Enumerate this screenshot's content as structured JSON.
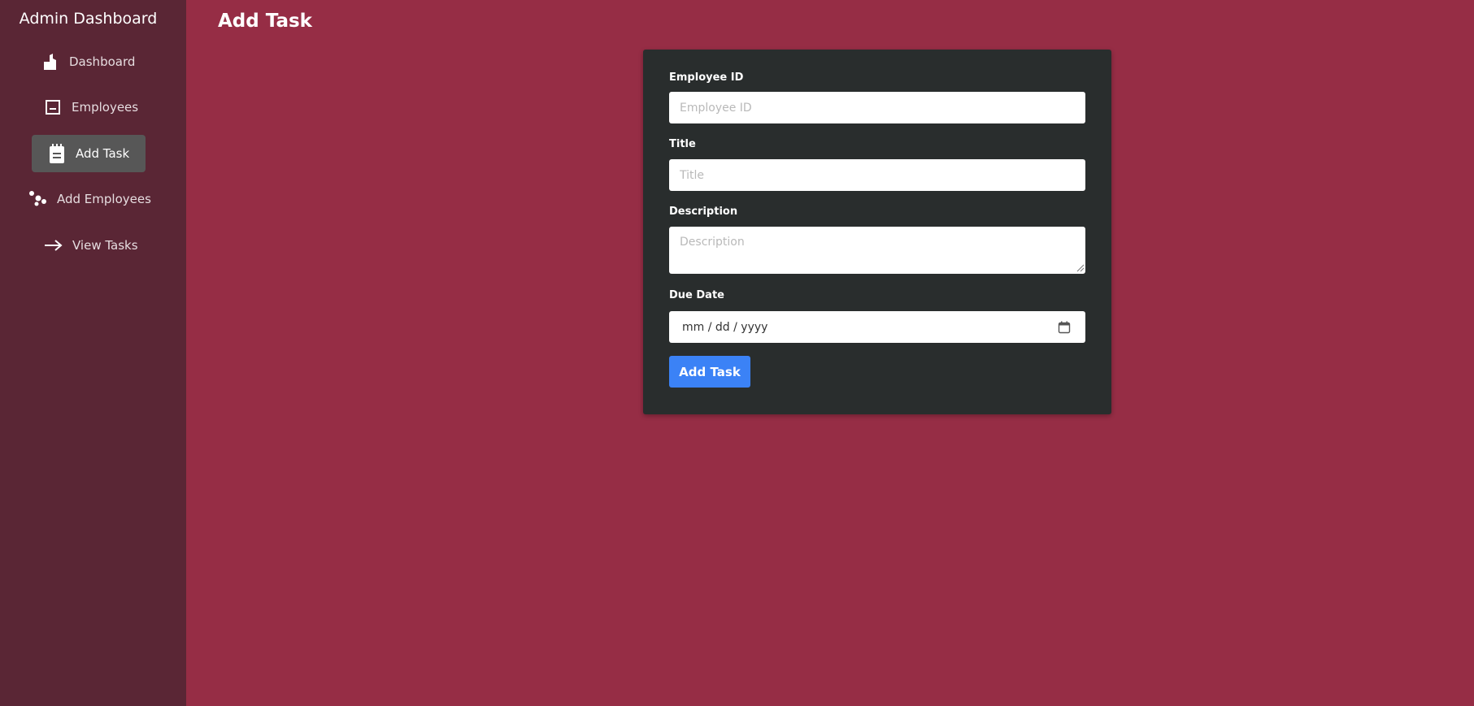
{
  "sidebar": {
    "title": "Admin Dashboard",
    "items": [
      {
        "label": "Dashboard",
        "icon": "dashboard-icon"
      },
      {
        "label": "Employees",
        "icon": "employees-icon"
      },
      {
        "label": "Add Task",
        "icon": "clipboard-icon",
        "active": true
      },
      {
        "label": "Add Employees",
        "icon": "add-employees-icon"
      },
      {
        "label": "View Tasks",
        "icon": "arrow-right-icon"
      }
    ]
  },
  "page": {
    "title": "Add Task"
  },
  "form": {
    "employee_id": {
      "label": "Employee ID",
      "placeholder": "Employee ID",
      "value": ""
    },
    "title": {
      "label": "Title",
      "placeholder": "Title",
      "value": ""
    },
    "description": {
      "label": "Description",
      "placeholder": "Description",
      "value": ""
    },
    "due_date": {
      "label": "Due Date",
      "placeholder": "mm / dd / yyyy",
      "icon": "calendar-icon"
    },
    "submit_label": "Add Task"
  },
  "colors": {
    "background": "#962d45",
    "sidebar": "#5a2635",
    "card": "#292d2d",
    "active_item": "#575757",
    "button": "#3b82f6"
  }
}
